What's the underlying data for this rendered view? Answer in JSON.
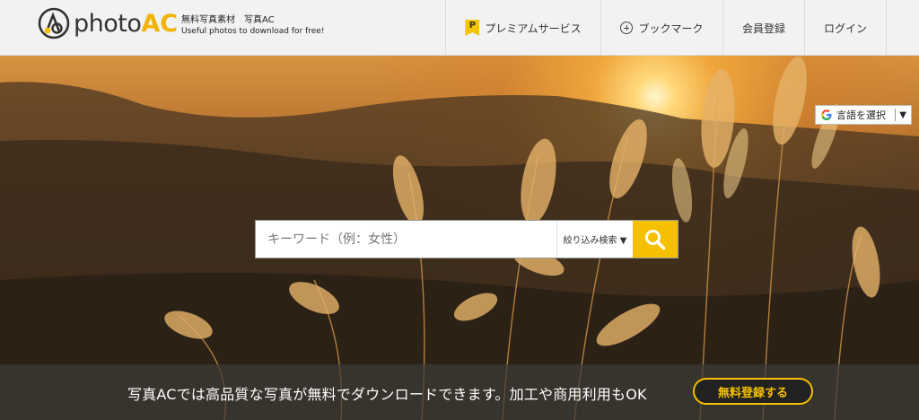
{
  "header": {
    "logo_photo": "photo",
    "logo_ac": "AC",
    "tagline": "無料写真素材　写真AC",
    "tagline_sub": "Useful photos to download for free!",
    "nav": {
      "premium": "プレミアムサービス",
      "premium_badge": "P",
      "bookmark": "ブックマーク",
      "register": "会員登録",
      "login": "ログイン"
    }
  },
  "language": {
    "label": "言語を選択",
    "arrow": "▼"
  },
  "search": {
    "placeholder": "キーワード（例：女性）",
    "filter_label": "絞り込み検索 ▼"
  },
  "banner": {
    "text": "写真ACでは高品質な写真が無料でダウンロードできます。加工や商用利用もOK",
    "button": "無料登録する"
  },
  "colors": {
    "accent": "#f5c000",
    "banner_bg": "#3c3a37"
  }
}
